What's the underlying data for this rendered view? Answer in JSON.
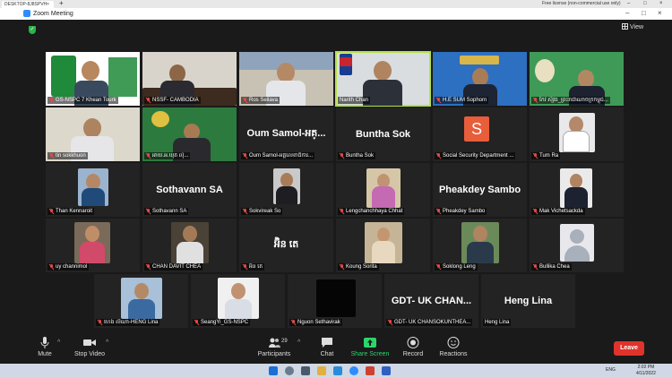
{
  "browser": {
    "tab_title": "DESKTOP-8J8SPVH",
    "tab_close": "×",
    "new_tab": "+",
    "notice": "Free license (non-commercial use only)",
    "minimize": "–",
    "maximize": "□",
    "close": "×"
  },
  "window": {
    "title": "Zoom Meeting",
    "minimize": "–",
    "maximize": "□",
    "close": "×"
  },
  "meeting": {
    "view_label": "View"
  },
  "participants": [
    {
      "name": "GS-NSPC 7 Khean Tourk",
      "muted": true
    },
    {
      "name": "NSSF- CAMBODIA",
      "muted": true
    },
    {
      "name": "Ros Seilava",
      "muted": true
    },
    {
      "name": "Narith Chan",
      "muted": false,
      "active": true
    },
    {
      "name": "H.E SUM Sophorn",
      "muted": true
    },
    {
      "name": "កែវ ស៊ីវុធ_ព្រះរាជាណាចក្រកម្ពុជ...",
      "muted": true
    },
    {
      "name": "tin sokkhuon",
      "muted": true
    },
    {
      "name": "អាយ.អ.ឃុត ល៉ុ...",
      "muted": true
    },
    {
      "name": "Oum Samol-អគ្គលេខាធិការ...",
      "muted": true,
      "big": "Oum Samol-អគ្...",
      "initial": ""
    },
    {
      "name": "Buntha Sok",
      "muted": true,
      "big": "Buntha Sok"
    },
    {
      "name": "Social Security Department ...",
      "muted": true,
      "initial": "S"
    },
    {
      "name": "Tum Ra",
      "muted": true
    },
    {
      "name": "Than Kennaroit",
      "muted": true
    },
    {
      "name": "Sothavann SA",
      "muted": true,
      "big": "Sothavann SA"
    },
    {
      "name": "Sokvireak So",
      "muted": true
    },
    {
      "name": "Lengchanchhaya Chhat",
      "muted": true
    },
    {
      "name": "Pheakdey Sambo",
      "muted": true,
      "big": "Pheakdey Sambo"
    },
    {
      "name": "Mak Vichetsackda",
      "muted": true
    },
    {
      "name": "uy channimol",
      "muted": true
    },
    {
      "name": "CHAN DAVIT CHEA",
      "muted": true
    },
    {
      "name": "អ៊ិន តេ",
      "muted": true,
      "big": "អ៊ិន តេ"
    },
    {
      "name": "Koung Sorita",
      "muted": true
    },
    {
      "name": "Soklong Leng",
      "muted": true
    },
    {
      "name": "Bullika Chea",
      "muted": true
    },
    {
      "name": "ហេង លីណា-HENG Lina",
      "muted": true
    },
    {
      "name": "SeangYi_GS-NSPC",
      "muted": true
    },
    {
      "name": "Nguon Sethavirak",
      "muted": true
    },
    {
      "name": "GDT- UK CHANSOKUNTHEA...",
      "muted": true,
      "big": "GDT- UK CHAN..."
    },
    {
      "name": "Heng Lina",
      "muted": false,
      "big": "Heng Lina"
    }
  ],
  "toolbar": {
    "mute": "Mute",
    "stop_video": "Stop Video",
    "participants": "Participants",
    "participants_count": "29",
    "chat": "Chat",
    "share_screen": "Share Screen",
    "record": "Record",
    "reactions": "Reactions",
    "leave": "Leave",
    "caret": "^"
  },
  "taskbar": {
    "lang": "ENG",
    "time": "2:02 PM",
    "date": "4/11/2022"
  },
  "colors": {
    "accent_green": "#b6e04a",
    "leave_red": "#e0332b",
    "share_green": "#2bd66a"
  }
}
